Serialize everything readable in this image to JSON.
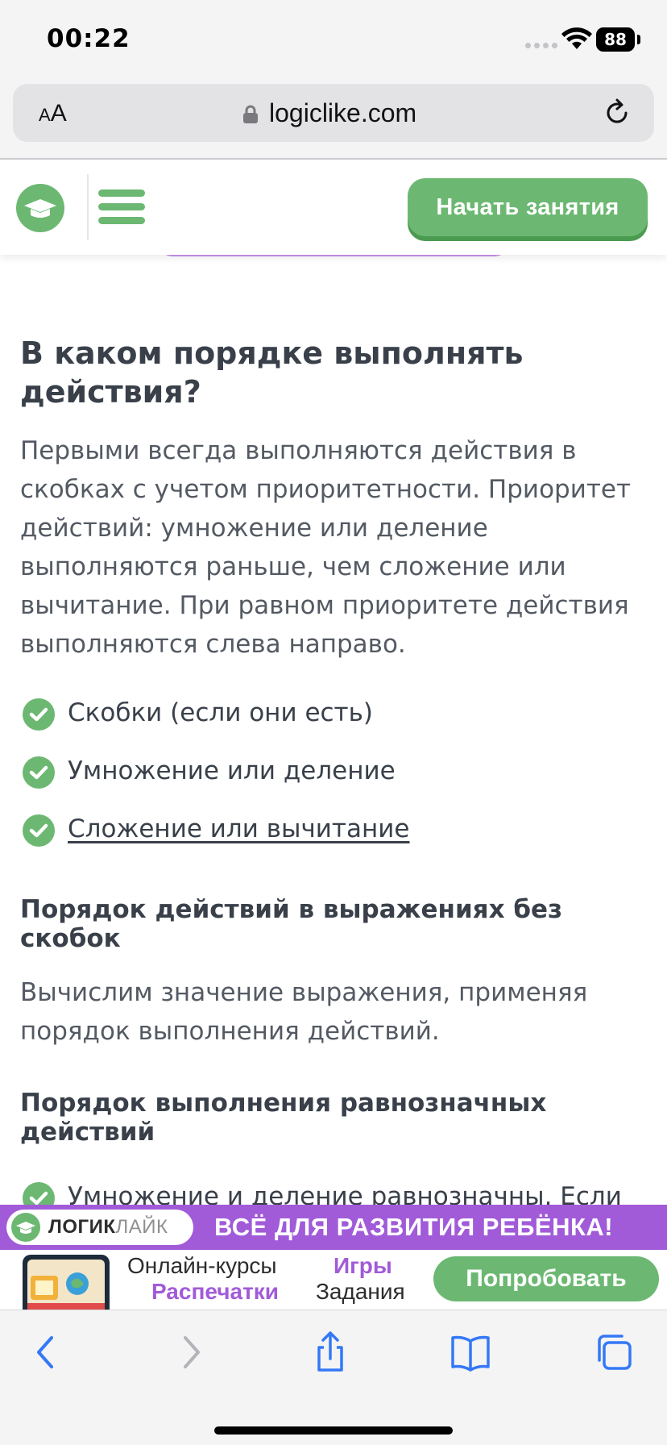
{
  "status_bar": {
    "time": "00:22",
    "battery": "88",
    "icons": [
      "signal-dots-icon",
      "wifi-icon",
      "battery-icon"
    ]
  },
  "browser": {
    "text_size_label_small": "A",
    "text_size_label_large": "A",
    "domain": "logiclike.com",
    "icons": [
      "lock-icon",
      "reload-icon"
    ]
  },
  "site_header": {
    "start_button": "Начать занятия",
    "icons": [
      "logo-graduation-cap-icon",
      "hamburger-menu-icon"
    ]
  },
  "article": {
    "heading": "В каком порядке выполнять действия?",
    "paragraph1": "Первыми всегда выполняются действия в скобках с учетом приоритетности. Приоритет действий: умножение или деление выполняются раньше, чем сложение или вычитание. При равном приоритете действия выполняются слева направо.",
    "checklist": [
      "Скобки (если они есть)",
      "Умножение или деление",
      "Сложение или вычитание"
    ],
    "subheading1": "Порядок действий в выражениях без скобок",
    "paragraph2": "Вычислим значение выражения, применяя порядок выполнения действий.",
    "subheading2": "Порядок выполнения равнозначных действий",
    "partial_item": "Умножение и деление равнозначны. Если"
  },
  "ad_banner": {
    "logo_bold": "ЛОГИК",
    "logo_light": "ЛАЙК",
    "headline": "ВСЁ ДЛЯ РАЗВИТИЯ РЕБЁНКА!",
    "item1": "Онлайн-курсы",
    "item2": "Распечатки",
    "item3": "Игры",
    "item4": "Задания",
    "button": "Попробовать",
    "colors": {
      "purple": "#a15bd8",
      "green": "#6cb872"
    }
  },
  "toolbar": {
    "icons": [
      "back-icon",
      "forward-icon",
      "share-icon",
      "bookmarks-icon",
      "tabs-icon"
    ]
  },
  "colors": {
    "accent_green": "#6cb872",
    "text_dark": "#39404a",
    "text_body": "#545a63",
    "browser_chrome": "#f4f4f5"
  }
}
